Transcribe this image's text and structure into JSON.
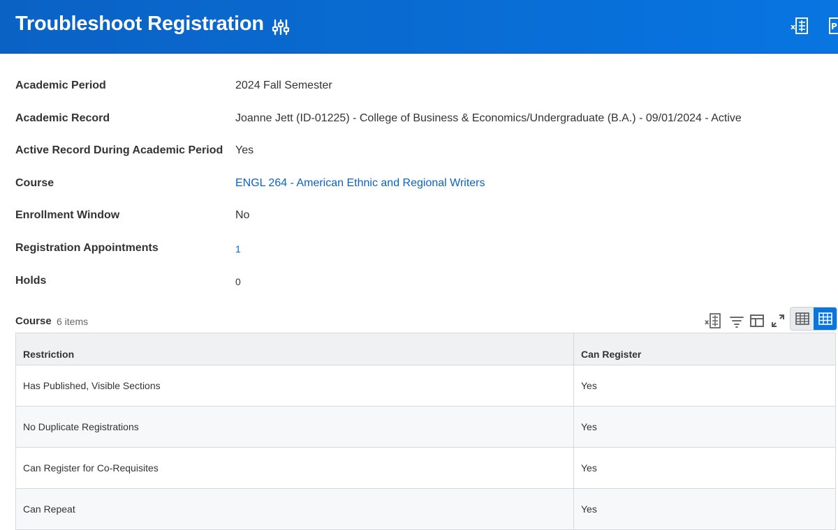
{
  "header": {
    "title": "Troubleshoot Registration",
    "icons": [
      "related-actions-icon",
      "export-excel-icon",
      "export-pdf-icon"
    ],
    "pdf_glyph": "P"
  },
  "fields": [
    {
      "label": "Academic Period",
      "value": "2024 Fall Semester"
    },
    {
      "label": "Academic Record",
      "value": "Joanne Jett (ID-01225) - College of Business & Economics/Undergraduate (B.A.) - 09/01/2024 - Active"
    },
    {
      "label": "Active Record During Academic Period",
      "value": "Yes"
    },
    {
      "label": "Course",
      "value": "ENGL 264 - American Ethnic and Regional Writers"
    },
    {
      "label": "Enrollment Window",
      "value": "No"
    },
    {
      "label": "Registration Appointments",
      "value": "1"
    },
    {
      "label": "Holds",
      "value": "0"
    }
  ],
  "grid": {
    "title": "Course",
    "count": "6 items",
    "toolbar": [
      "export-excel-icon",
      "filter-icon",
      "column-layout-icon",
      "fullscreen-icon",
      "table-view-icon",
      "grid-view-icon"
    ],
    "columns": [
      "Restriction",
      "Can Register"
    ],
    "rows": [
      [
        "Has Published, Visible Sections",
        "Yes"
      ],
      [
        "No Duplicate Registrations",
        "Yes"
      ],
      [
        "Can Register for Co-Requisites",
        "Yes"
      ],
      [
        "Can Repeat",
        "Yes"
      ]
    ]
  },
  "colors": {
    "header_bg": "#0875e1",
    "link": "#0b62c4",
    "text": "#333333"
  }
}
